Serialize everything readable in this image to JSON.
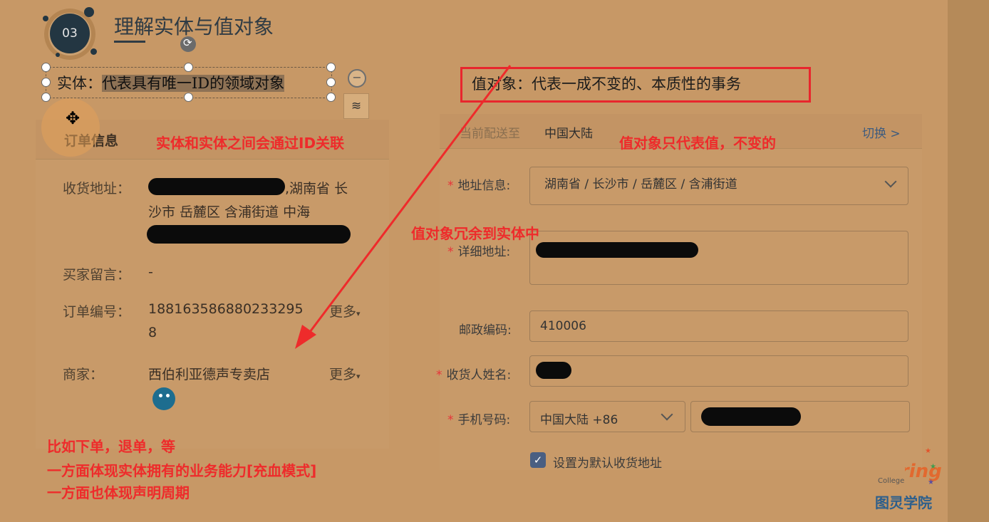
{
  "header": {
    "badge_number": "03",
    "title": "理解实体与值对象"
  },
  "entity_text": {
    "prefix": "实体：",
    "highlight": "代表具有唯一ID的领域对象"
  },
  "value_object_text": "值对象：代表一成不变的、本质性的事务",
  "order_card": {
    "title": "订单信息",
    "address_label": "收货地址：",
    "address_line1_suffix": ",湖南省 长",
    "address_line2": "沙市 岳麓区 含浦街道 中海",
    "buyer_note_label": "买家留言：",
    "buyer_note_value": "-",
    "order_no_label": "订单编号：",
    "order_no_line1": "188163586880233295",
    "order_no_line2": "8",
    "more_1": "更多",
    "merchant_label": "商家：",
    "merchant_value": "西伯利亚德声专卖店",
    "more_2": "更多"
  },
  "address_form": {
    "ship_to_label": "当前配送至",
    "ship_to_value": "中国大陆",
    "switch_link": "切换 >",
    "region_label": "地址信息:",
    "region_value": "湖南省 / 长沙市 / 岳麓区 / 含浦街道",
    "detail_label": "详细地址:",
    "postcode_label": "邮政编码:",
    "postcode_value": "410006",
    "name_label": "收货人姓名:",
    "phone_label": "手机号码:",
    "phone_country": "中国大陆 +86",
    "default_label": "设置为默认收货地址",
    "default_checked": true
  },
  "annotations": {
    "id_link": "实体和实体之间会通过ID关联",
    "vo_only_value": "值对象只代表值，不变的",
    "vo_redundant": "值对象冗余到实体中",
    "notes": [
      "比如下单，退单，等",
      "一方面体现实体拥有的业务能力[充血模式]",
      "一方面也体现声明周期"
    ]
  },
  "brand": {
    "en": "Turing",
    "small": "College",
    "cn": "图灵学院"
  },
  "colors": {
    "annotation_red": "#ee2b2b",
    "badge": "#233642",
    "slide_bg": "#c79866"
  }
}
